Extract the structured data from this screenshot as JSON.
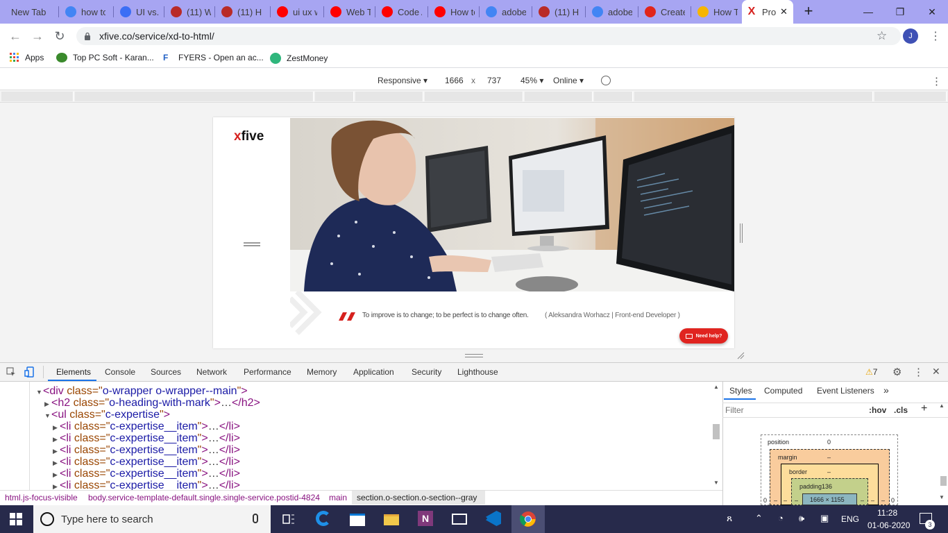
{
  "tabs": [
    {
      "title": "New Tab",
      "icon": "none",
      "color": ""
    },
    {
      "title": "how to",
      "icon": "google-icon",
      "color": "#4285f4"
    },
    {
      "title": "UI vs. U",
      "icon": "ux-site-icon",
      "color": "#3b6ef5"
    },
    {
      "title": "(11) W",
      "icon": "quora-icon",
      "color": "#b92b27"
    },
    {
      "title": "(11) H",
      "icon": "quora-icon",
      "color": "#b92b27"
    },
    {
      "title": "ui ux w",
      "icon": "youtube-icon",
      "color": "#ff0000"
    },
    {
      "title": "Web T",
      "icon": "youtube-icon",
      "color": "#ff0000"
    },
    {
      "title": "Code A",
      "icon": "youtube-icon",
      "color": "#ff0000"
    },
    {
      "title": "How to",
      "icon": "youtube-icon",
      "color": "#ff0000"
    },
    {
      "title": "adobe",
      "icon": "google-icon",
      "color": "#4285f4"
    },
    {
      "title": "(11) H",
      "icon": "quora-icon",
      "color": "#b92b27"
    },
    {
      "title": "adobe",
      "icon": "google-icon",
      "color": "#4285f4"
    },
    {
      "title": "Create",
      "icon": "adobe-icon",
      "color": "#e1251b"
    },
    {
      "title": "How T",
      "icon": "f-icon",
      "color": "#f7b500"
    }
  ],
  "active_tab": {
    "title": "Pro",
    "icon": "xfive-icon"
  },
  "address": {
    "url": "xfive.co/service/xd-to-html/",
    "profile_initial": "J"
  },
  "bookmarks": [
    {
      "label": "Apps",
      "icon": "apps-grid-icon"
    },
    {
      "label": "Top PC Soft - Karan...",
      "icon": "frog-icon"
    },
    {
      "label": "FYERS - Open an ac...",
      "icon": "fyers-icon"
    },
    {
      "label": "ZestMoney",
      "icon": "zestmoney-icon"
    }
  ],
  "device_toolbar": {
    "mode": "Responsive",
    "width": "1666",
    "times": "x",
    "height": "737",
    "zoom": "45%",
    "network": "Online"
  },
  "site": {
    "logo_x": "x",
    "logo_rest": "five",
    "quote": "To improve is to change; to be perfect is to change often.",
    "author": "( Aleksandra Worhacz  |  Front-end Developer )",
    "help_button": "Need help?"
  },
  "devtools": {
    "tabs": [
      "Elements",
      "Console",
      "Sources",
      "Network",
      "Performance",
      "Memory",
      "Application",
      "Security",
      "Lighthouse"
    ],
    "warnings": "7",
    "dom_lines": [
      {
        "indent": 0,
        "open": true,
        "tag": "div",
        "attr": "class",
        "value": "o-wrapper o-wrapper--main",
        "close": ""
      },
      {
        "indent": 1,
        "open": false,
        "tag": "h2",
        "attr": "class",
        "value": "o-heading-with-mark",
        "close": "h2"
      },
      {
        "indent": 1,
        "open": true,
        "tag": "ul",
        "attr": "class",
        "value": "c-expertise",
        "close": ""
      },
      {
        "indent": 2,
        "open": false,
        "tag": "li",
        "attr": "class",
        "value": "c-expertise__item",
        "close": "li"
      },
      {
        "indent": 2,
        "open": false,
        "tag": "li",
        "attr": "class",
        "value": "c-expertise__item",
        "close": "li"
      },
      {
        "indent": 2,
        "open": false,
        "tag": "li",
        "attr": "class",
        "value": "c-expertise__item",
        "close": "li"
      },
      {
        "indent": 2,
        "open": false,
        "tag": "li",
        "attr": "class",
        "value": "c-expertise__item",
        "close": "li"
      },
      {
        "indent": 2,
        "open": false,
        "tag": "li",
        "attr": "class",
        "value": "c-expertise__item",
        "close": "li"
      },
      {
        "indent": 2,
        "open": false,
        "tag": "li",
        "attr": "class",
        "value": "c-expertise__item",
        "close": "li"
      }
    ],
    "breadcrumbs": [
      "html.js-focus-visible",
      "body.service-template-default.single.single-service.postid-4824",
      "main",
      "section.o-section.o-section--gray"
    ],
    "styles_tabs": [
      "Styles",
      "Computed",
      "Event Listeners"
    ],
    "filter_placeholder": "Filter",
    "hov": ":hov",
    "cls": ".cls",
    "box_model": {
      "position_label": "position",
      "position_value": "0",
      "margin_label": "margin",
      "margin_value": "–",
      "border_label": "border",
      "border_value": "–",
      "padding_label": "padding136",
      "content": "1666 × 1155",
      "side_zero": "0",
      "dash": "–"
    }
  },
  "taskbar": {
    "search_placeholder": "Type here to search",
    "lang": "ENG",
    "time": "11:28",
    "date": "01-06-2020",
    "notifications": "3"
  }
}
